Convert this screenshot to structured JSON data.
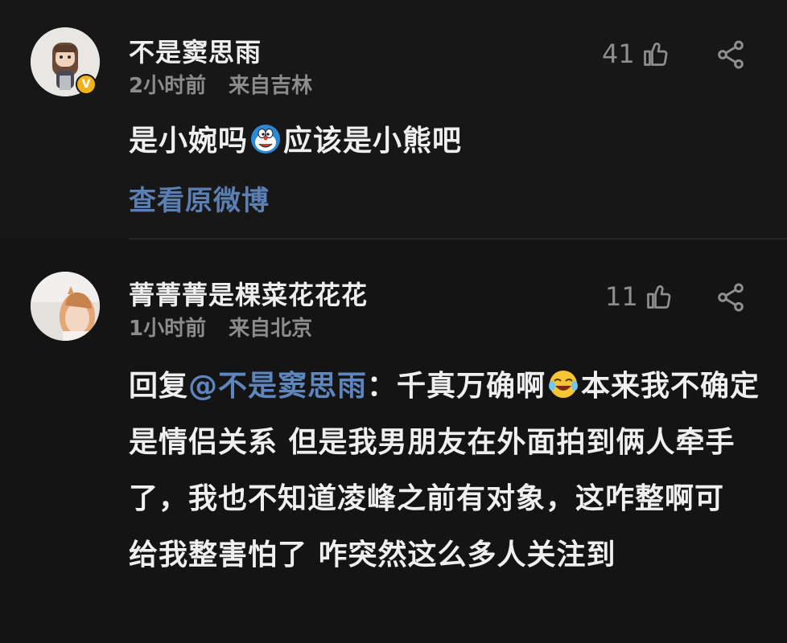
{
  "comments": [
    {
      "username": "不是窦思雨",
      "time": "2小时前",
      "location": "来自吉林",
      "likes": "41",
      "text_part1": "是小婉吗",
      "emoji_1": "doraemon-emoji",
      "text_part2": "应该是小熊吧",
      "view_original": "查看原微博",
      "verified_mark": "V"
    },
    {
      "username": "菁菁菁是棵菜花花花",
      "time": "1小时前",
      "location": "来自北京",
      "likes": "11",
      "reply_prefix": "回复",
      "mention": "@不是窦思雨",
      "text_part1": "：千真万确啊",
      "emoji_1": "laugh-cry-emoji",
      "text_part2": "本来我不确定是情侣关系 但是我男朋友在外面拍到俩人牵手了，我也不知道凌峰之前有对象，这咋整啊可 给我整害怕了 咋突然这么多人关注到"
    }
  ],
  "icons": {
    "like": "thumbs-up-icon",
    "share": "share-icon"
  }
}
